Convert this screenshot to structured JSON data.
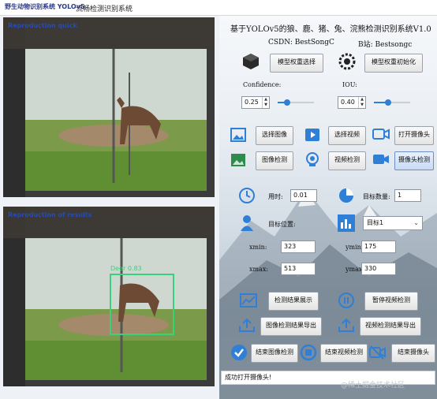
{
  "window": {
    "title": "流畅检测识别系统",
    "logo_text": "野生动物识别系统 YOLOv5"
  },
  "left": {
    "top_pane_label": "Reproduction quick",
    "bottom_pane_label": "Reproduction of results",
    "detection": {
      "label": "Deer 0.83"
    }
  },
  "panel": {
    "title": "基于YOLOv5的狼、鹿、猪、兔、浣熊检测识别系统V1.0",
    "subtitle_csdn": "CSDN:   BestSongC",
    "subtitle_bili": "B站: Bestsongc",
    "model_select": "模型权重选择",
    "model_init": "模型权重初始化",
    "confidence_label": "Confidence:",
    "confidence_value": "0.25",
    "iou_label": "IOU:",
    "iou_value": "0.40",
    "btn_select_image": "选择图像",
    "btn_select_video": "选择视频",
    "btn_open_camera": "打开摄像头",
    "btn_image_detect": "图像检测",
    "btn_video_detect": "视频检测",
    "btn_camera_detect": "摄像头检测",
    "time_label": "用时:",
    "time_value": "0.01",
    "count_label": "目标数量:",
    "count_value": "1",
    "position_label": "目标位置:",
    "target_select": "目标1",
    "xmin_label": "xmin:",
    "xmin_value": "323",
    "ymin_label": "ymin:",
    "ymin_value": "175",
    "xmax_label": "xmax:",
    "xmax_value": "513",
    "ymax_label": "ymax:",
    "ymax_value": "330",
    "btn_show_result": "检测结果展示",
    "btn_pause_video": "暂停视频检测",
    "btn_export_image": "图像检测结果导出",
    "btn_export_video": "视频检测结果导出",
    "btn_end_image": "结束图像检测",
    "btn_end_video": "结束视频检测",
    "btn_end_camera": "结束摄像头",
    "status_text": "成功打开摄像头!",
    "watermark": "@稀土掘金技术社区"
  },
  "colors": {
    "accent": "#2f7fd6",
    "detect_box": "#38d27a"
  },
  "chart_data": {
    "slider_confidence": 0.25,
    "slider_iou": 0.4
  }
}
